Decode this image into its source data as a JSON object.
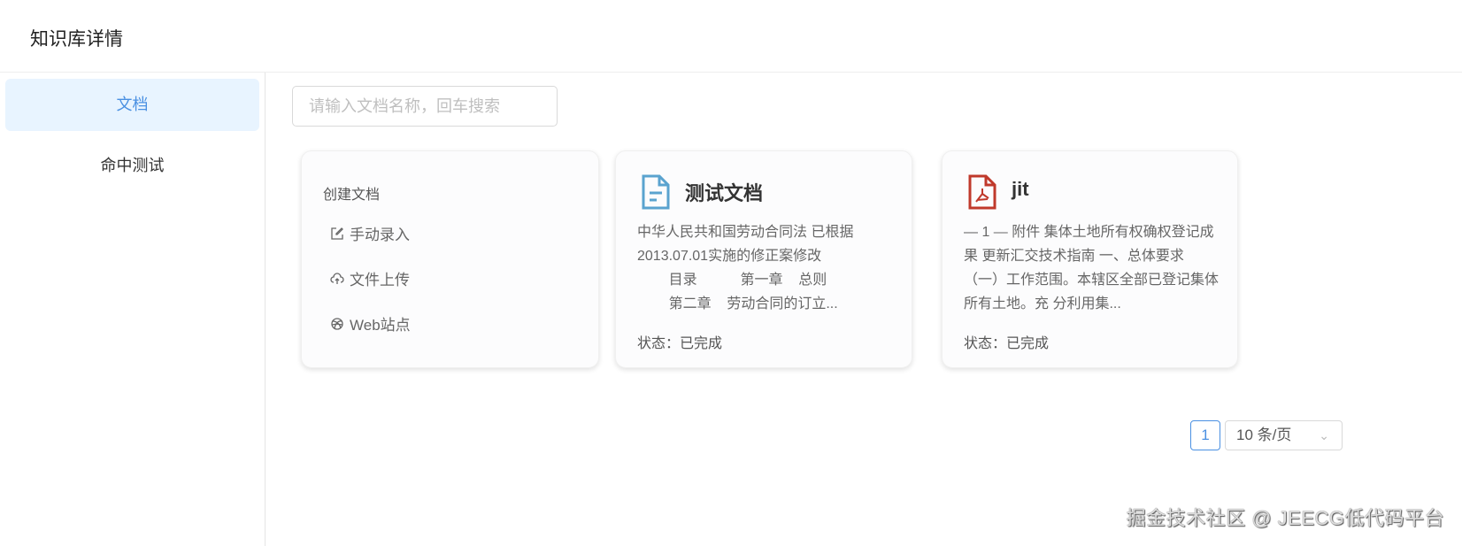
{
  "header": {
    "title": "知识库详情"
  },
  "sidebar": {
    "items": [
      {
        "label": "文档",
        "active": true
      },
      {
        "label": "命中测试",
        "active": false
      }
    ]
  },
  "search": {
    "placeholder": "请输入文档名称，回车搜索",
    "value": ""
  },
  "create_card": {
    "title": "创建文档",
    "items": [
      {
        "label": "手动录入",
        "icon": "edit-icon"
      },
      {
        "label": "文件上传",
        "icon": "cloud-upload-icon"
      },
      {
        "label": "Web站点",
        "icon": "globe-icon"
      }
    ]
  },
  "documents": [
    {
      "title": "测试文档",
      "icon": "text-file-icon",
      "excerpt": "中华人民共和国劳动合同法 已根据2013.07.01实施的修正案修改\n        目录           第一章    总则\n        第二章    劳动合同的订立...",
      "status": "状态：已完成"
    },
    {
      "title": "jit",
      "icon": "pdf-file-icon",
      "excerpt": "— 1 — 附件 集体土地所有权确权登记成果 更新汇交技术指南 一、总体要求 （一）工作范围。本辖区全部已登记集体所有土地。充 分利用集...",
      "status": "状态：已完成"
    }
  ],
  "pagination": {
    "current": "1",
    "page_size": "10 条/页"
  },
  "watermark": "掘金技术社区 @ JEECG低代码平台",
  "colors": {
    "accent": "#4a90e2",
    "active_bg": "#e8f4ff",
    "doc_icon": "#5aa3cf",
    "pdf_icon": "#c0392b"
  }
}
